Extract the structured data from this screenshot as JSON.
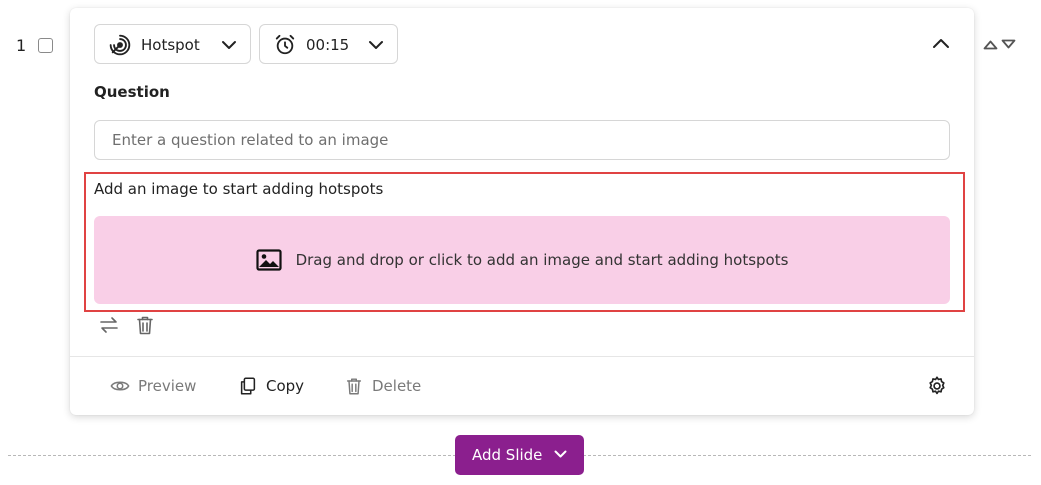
{
  "slide": {
    "number": "1"
  },
  "header": {
    "type_label": "Hotspot",
    "time_label": "00:15"
  },
  "question": {
    "label": "Question",
    "placeholder": "Enter a question related to an image",
    "value": ""
  },
  "hotspot": {
    "title": "Add an image to start adding hotspots",
    "drop_text": "Drag and drop or click to add an image and start adding hotspots"
  },
  "footer": {
    "preview_label": "Preview",
    "copy_label": "Copy",
    "delete_label": "Delete"
  },
  "add_slide": {
    "label": "Add Slide"
  },
  "colors": {
    "accent": "#8b1f8e",
    "drop_bg": "#f9cfe7",
    "highlight_border": "#e04343"
  },
  "icons": [
    "hotspot-icon",
    "alarm-clock-icon",
    "chevron-down-icon",
    "chevron-up-icon",
    "image-icon",
    "swap-icon",
    "trash-icon",
    "eye-icon",
    "copy-icon",
    "gear-icon",
    "move-up-icon",
    "move-down-icon"
  ]
}
